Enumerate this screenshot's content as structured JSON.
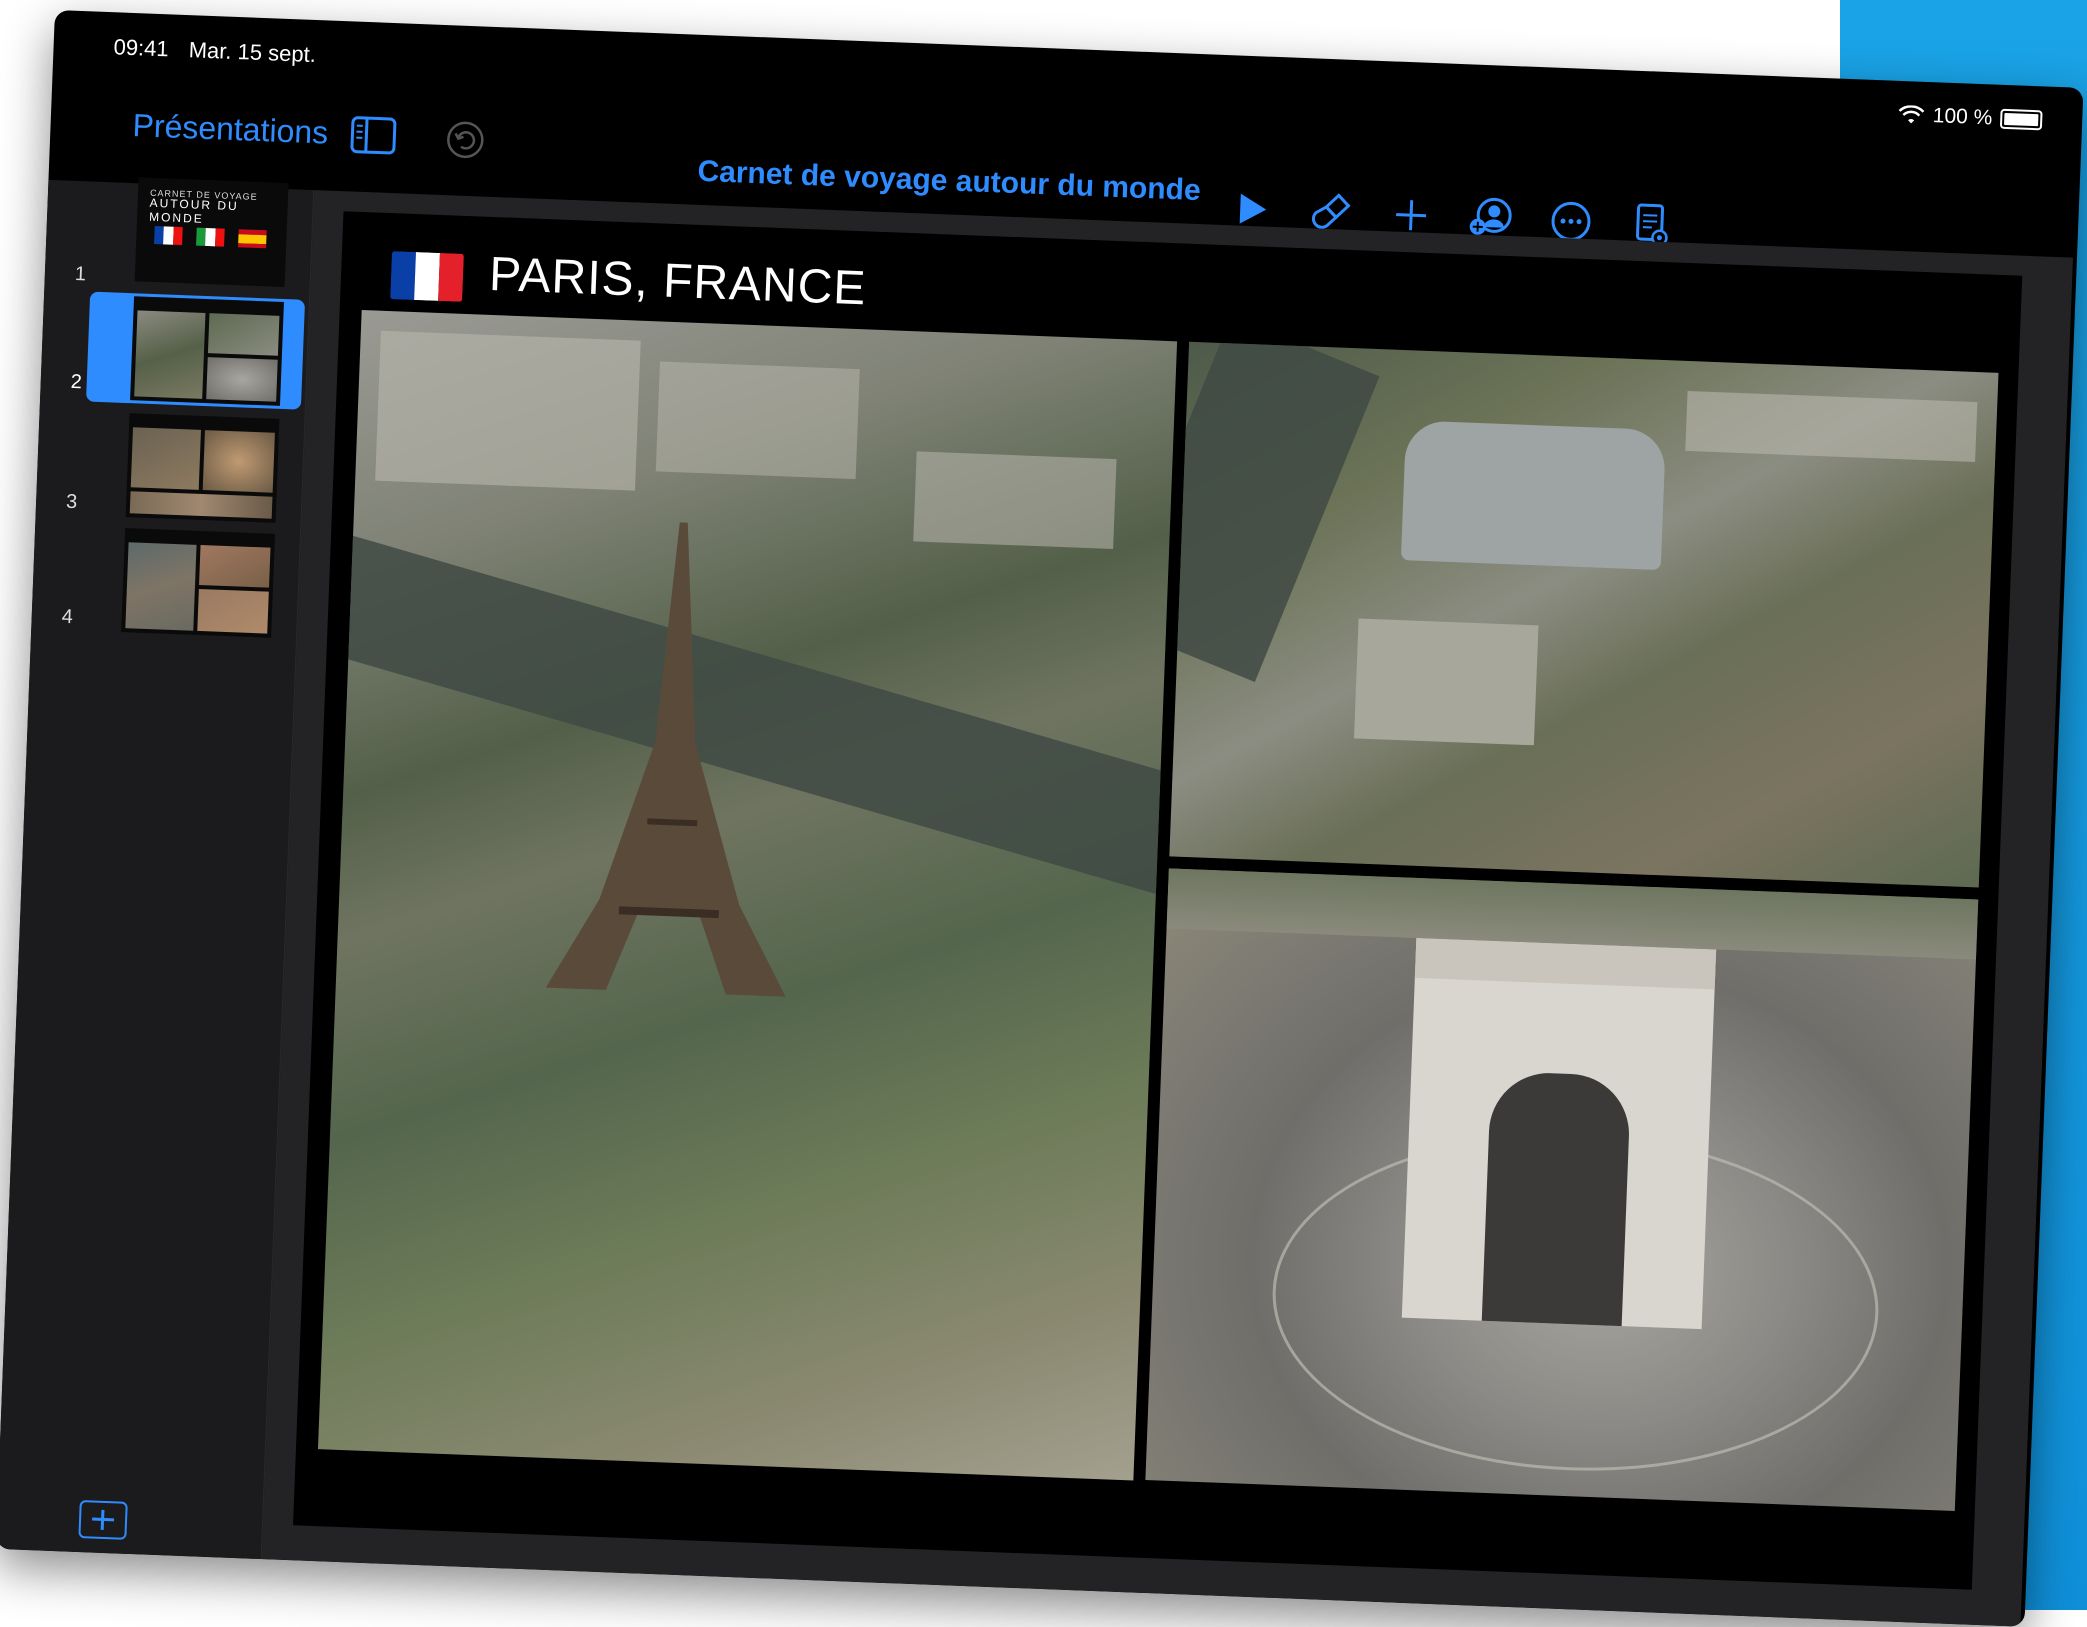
{
  "status_bar": {
    "time": "09:41",
    "date": "Mar. 15 sept.",
    "battery": "100 %"
  },
  "toolbar": {
    "back_label": "Présentations",
    "document_title": "Carnet de voyage autour du monde"
  },
  "navigator": {
    "slides": [
      {
        "number": "1",
        "title_small": "CARNET DE VOYAGE",
        "title_big": "AUTOUR DU MONDE"
      },
      {
        "number": "2"
      },
      {
        "number": "3"
      },
      {
        "number": "4"
      }
    ],
    "selected_index": 2
  },
  "slide": {
    "title": "PARIS, FRANCE"
  },
  "colors": {
    "accent": "#2f8cff",
    "canvas": "#232326",
    "navigator": "#1b1b1d"
  }
}
